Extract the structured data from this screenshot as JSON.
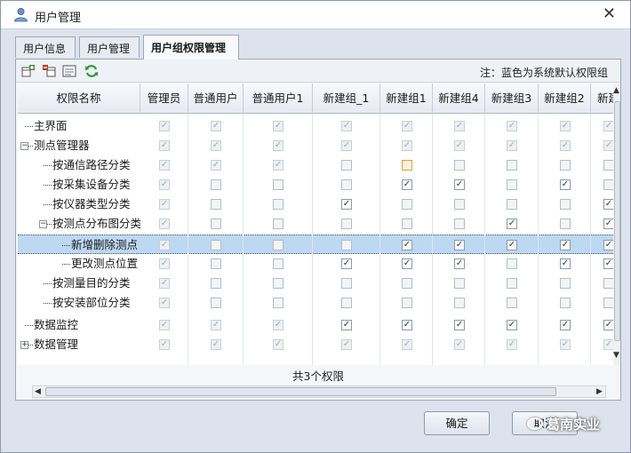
{
  "window": {
    "title": "用户管理",
    "close_label": "✕"
  },
  "tabs": [
    {
      "label": "用户信息",
      "active": false
    },
    {
      "label": "用户管理",
      "active": false
    },
    {
      "label": "用户组权限管理",
      "active": true
    }
  ],
  "toolbar": {
    "icons": [
      "add-column-icon",
      "delete-column-icon",
      "properties-icon",
      "refresh-icon"
    ],
    "note": "注：蓝色为系统默认权限组"
  },
  "grid": {
    "first_column_header": "权限名称",
    "columns": [
      "管理员",
      "普通用户",
      "普通用户1",
      "新建组_1",
      "新建组1",
      "新建组4",
      "新建组3",
      "新建组2",
      "新建"
    ],
    "rows": [
      {
        "name": "主界面",
        "level": 0,
        "expander": "",
        "selected": false,
        "checks": [
          "d",
          "d",
          "d",
          "d",
          "d",
          "d",
          "d",
          "d",
          "d"
        ]
      },
      {
        "name": "测点管理器",
        "level": 0,
        "expander": "−",
        "selected": false,
        "checks": [
          "d",
          "d",
          "d",
          "d",
          "d",
          "d",
          "d",
          "d",
          "d"
        ]
      },
      {
        "name": "按通信路径分类",
        "level": 1,
        "expander": "",
        "selected": false,
        "checks": [
          "d",
          "d",
          "d",
          "",
          "h",
          "",
          "",
          "",
          ""
        ]
      },
      {
        "name": "按采集设备分类",
        "level": 1,
        "expander": "",
        "selected": false,
        "checks": [
          "d",
          "",
          "",
          "",
          "c",
          "c",
          "",
          "c",
          ""
        ]
      },
      {
        "name": "按仪器类型分类",
        "level": 1,
        "expander": "",
        "selected": false,
        "checks": [
          "d",
          "",
          "",
          "c",
          "",
          "",
          "",
          "",
          "c"
        ]
      },
      {
        "name": "按测点分布图分类",
        "level": 1,
        "expander": "−",
        "selected": false,
        "checks": [
          "d",
          "",
          "",
          "",
          "",
          "",
          "c",
          "",
          "c"
        ]
      },
      {
        "name": "新增删除测点",
        "level": 2,
        "expander": "",
        "selected": true,
        "checks": [
          "d",
          "",
          "",
          "",
          "c",
          "c",
          "c",
          "c",
          "c"
        ]
      },
      {
        "name": "更改测点位置",
        "level": 2,
        "expander": "",
        "selected": false,
        "checks": [
          "d",
          "",
          "",
          "c",
          "c",
          "c",
          "",
          "c",
          "c"
        ]
      },
      {
        "name": "按测量目的分类",
        "level": 1,
        "expander": "",
        "selected": false,
        "checks": [
          "d",
          "",
          "",
          "",
          "",
          "",
          "",
          "",
          ""
        ]
      },
      {
        "name": "按安装部位分类",
        "level": 1,
        "expander": "",
        "selected": false,
        "checks": [
          "d",
          "",
          "",
          "",
          "",
          "",
          "",
          "",
          ""
        ]
      },
      {
        "name": "数据监控",
        "level": 0,
        "expander": "",
        "selected": false,
        "checks": [
          "d",
          "d",
          "d",
          "c",
          "c",
          "c",
          "c",
          "c",
          "c"
        ]
      },
      {
        "name": "数据管理",
        "level": 0,
        "expander": "+",
        "selected": false,
        "checks": [
          "d",
          "d",
          "d",
          "d",
          "d",
          "d",
          "d",
          "d",
          "d"
        ]
      }
    ]
  },
  "footer": {
    "count_text": "共3个权限"
  },
  "buttons": {
    "ok": "确定",
    "cancel": "取消"
  },
  "watermark": "葛南实业"
}
